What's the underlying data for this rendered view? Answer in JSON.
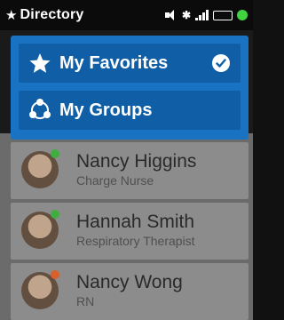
{
  "status_bar": {
    "star": "★",
    "title": "Directory",
    "icons": [
      "volume-icon",
      "bluetooth-icon",
      "signal-icon",
      "battery-icon",
      "status-green-dot"
    ]
  },
  "menu": {
    "items": [
      {
        "label": "My Favorites",
        "icon": "star-icon",
        "selected": true,
        "badge_icon": "check-circle-icon"
      },
      {
        "label": "My Groups",
        "icon": "group-icon",
        "selected": false
      }
    ],
    "color_panel": "#1a73c2",
    "color_item": "#0f5ea6"
  },
  "contacts": [
    {
      "name": "Nancy Higgins",
      "role": "Charge Nurse",
      "presence_color": "#3fae3f"
    },
    {
      "name": "Hannah Smith",
      "role": "Respiratory Therapist",
      "presence_color": "#3fae3f"
    },
    {
      "name": "Nancy Wong",
      "role": "RN",
      "presence_color": "#d9602a"
    }
  ]
}
